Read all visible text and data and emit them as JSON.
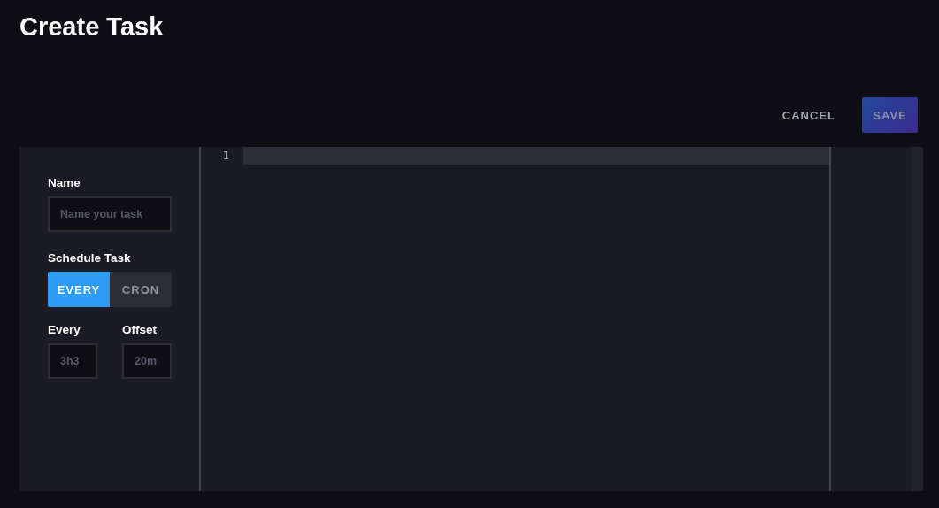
{
  "page": {
    "title": "Create Task"
  },
  "actions": {
    "cancel": "CANCEL",
    "save": {
      "label": "SAVE",
      "disabled": true
    }
  },
  "form": {
    "name": {
      "label": "Name",
      "placeholder": "Name your task"
    },
    "schedule": {
      "label": "Schedule Task",
      "options": [
        {
          "label": "EVERY",
          "selected": true
        },
        {
          "label": "CRON",
          "selected": false
        }
      ]
    },
    "fields": [
      {
        "label": "Every",
        "placeholder": "3h3"
      },
      {
        "label": "Offset",
        "placeholder": "20m"
      }
    ]
  },
  "editor": {
    "line_numbers": [
      "1"
    ]
  }
}
